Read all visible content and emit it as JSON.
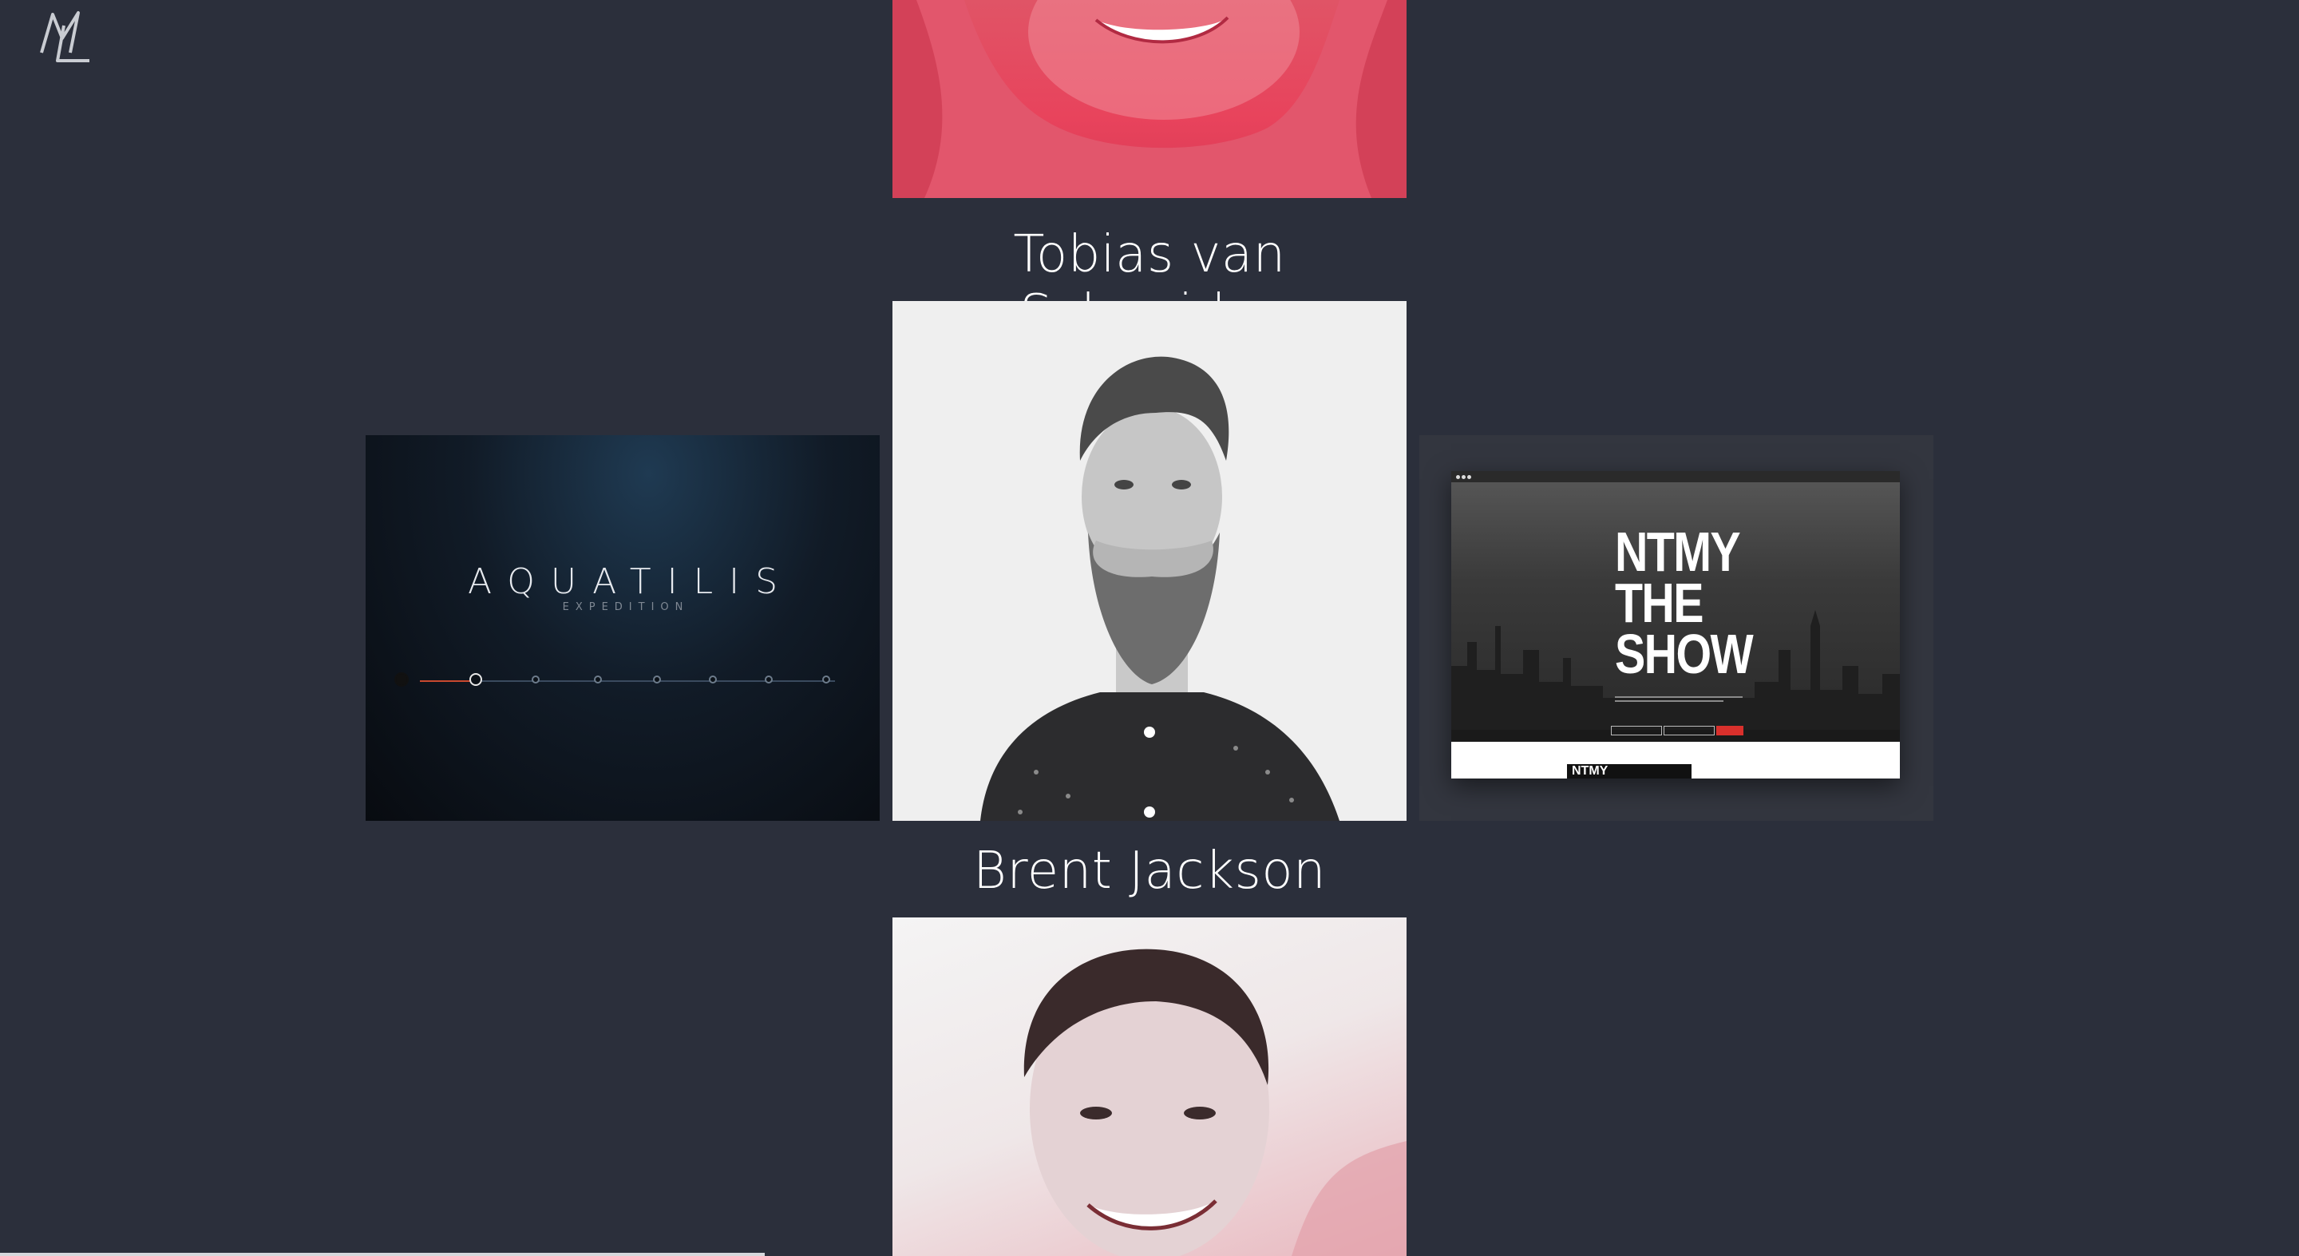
{
  "logo": {
    "text": "ML"
  },
  "people": [
    {
      "name": ""
    },
    {
      "name": "Tobias van Schneider"
    },
    {
      "name": "Brent Jackson"
    }
  ],
  "projects": {
    "left": {
      "title": "AQUATILIS",
      "subtitle": "EXPEDITION"
    },
    "right": {
      "headline_line1": "NTMY",
      "headline_line2": "THE",
      "headline_line3": "SHOW",
      "buttons": [
        "",
        "",
        ""
      ],
      "poster_text": "NTMY"
    }
  },
  "colors": {
    "background": "#2b2f3b",
    "accent_pink": "#e8435c",
    "aquatilis_active": "#c9492f"
  }
}
